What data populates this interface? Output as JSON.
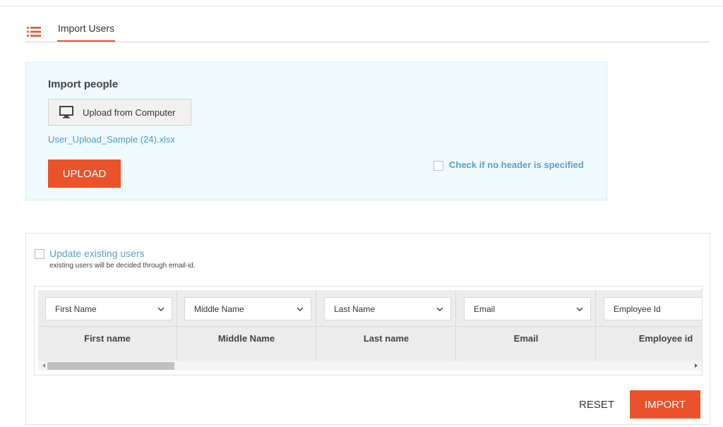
{
  "tabs": {
    "active_label": "Import Users"
  },
  "import_panel": {
    "title": "Import people",
    "upload_from_computer_label": "Upload from Computer",
    "selected_file": "User_Upload_Sample (24).xlsx",
    "upload_button_label": "UPLOAD",
    "no_header_label": "Check if no header is specified",
    "no_header_checked": false
  },
  "mapping_panel": {
    "update_existing_label": "Update existing users",
    "update_existing_help": "existing users will be decided through email-id.",
    "update_existing_checked": false,
    "columns": [
      {
        "select_value": "First Name",
        "header": "First name"
      },
      {
        "select_value": "Middle Name",
        "header": "Middle Name"
      },
      {
        "select_value": "Last Name",
        "header": "Last name"
      },
      {
        "select_value": "Email",
        "header": "Email"
      },
      {
        "select_value": "Employee Id",
        "header": "Employee id"
      }
    ],
    "reset_label": "RESET",
    "import_label": "IMPORT"
  },
  "colors": {
    "accent": "#e9522a",
    "link": "#5f9dc3",
    "panel_bg": "#eefafd"
  },
  "icons": {
    "tab_icon": "list-icon",
    "upload_icon": "monitor-icon",
    "select_icon": "chevron-down-icon"
  }
}
